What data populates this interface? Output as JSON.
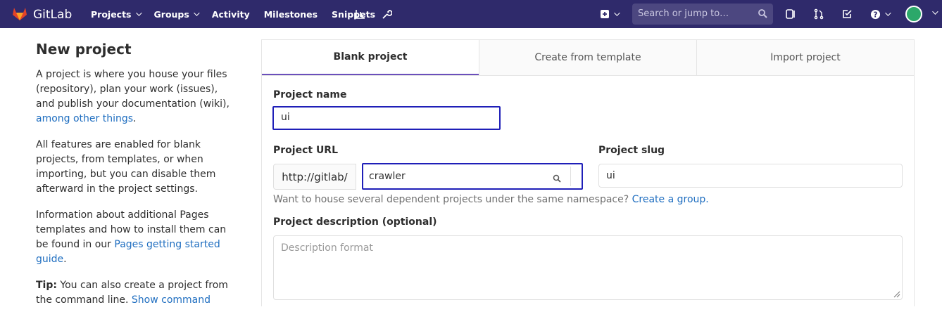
{
  "header": {
    "brand": "GitLab",
    "nav": [
      {
        "label": "Projects",
        "dropdown": true
      },
      {
        "label": "Groups",
        "dropdown": true
      },
      {
        "label": "Activity",
        "dropdown": false
      },
      {
        "label": "Milestones",
        "dropdown": false
      },
      {
        "label": "Snippets",
        "dropdown": false
      }
    ],
    "icons": [
      "chart-icon",
      "wrench-icon",
      "plus-square-icon",
      "sidebar-panel-icon",
      "merge-request-icon",
      "todo-check-icon",
      "help-icon"
    ],
    "search_placeholder": "Search or jump to…",
    "colors": {
      "navbar": "#2f2a6b",
      "search_bg": "#4c4780"
    }
  },
  "intro": {
    "title": "New project",
    "p1_text": "A project is where you house your files (repository), plan your work (issues), and publish your documentation (wiki),",
    "p1_link": "among other things",
    "p1_end": ".",
    "p2": "All features are enabled for blank projects, from templates, or when importing, but you can disable them afterward in the project settings.",
    "p3_text": "Information about additional Pages templates and how to install them can be found in our",
    "p3_link": "Pages getting started guide",
    "p3_end": ".",
    "tip_label": "Tip:",
    "tip_text": "You can also create a project from the command line.",
    "tip_link": "Show command"
  },
  "tabs": [
    {
      "label": "Blank project",
      "active": true
    },
    {
      "label": "Create from template",
      "active": false
    },
    {
      "label": "Import project",
      "active": false
    }
  ],
  "form": {
    "name_label": "Project name",
    "name_value": "ui",
    "url_label": "Project URL",
    "url_prefix": "http://gitlab/",
    "namespace_value": "crawler",
    "slug_label": "Project slug",
    "slug_value": "ui",
    "help_text": "Want to house several dependent projects under the same namespace?",
    "help_link": "Create a group.",
    "description_label": "Project description (optional)",
    "description_placeholder": "Description format"
  },
  "accent": {
    "link": "#1f6ec0",
    "active_tab": "#6b4fbb",
    "focus_border": "#1f1fb8"
  }
}
